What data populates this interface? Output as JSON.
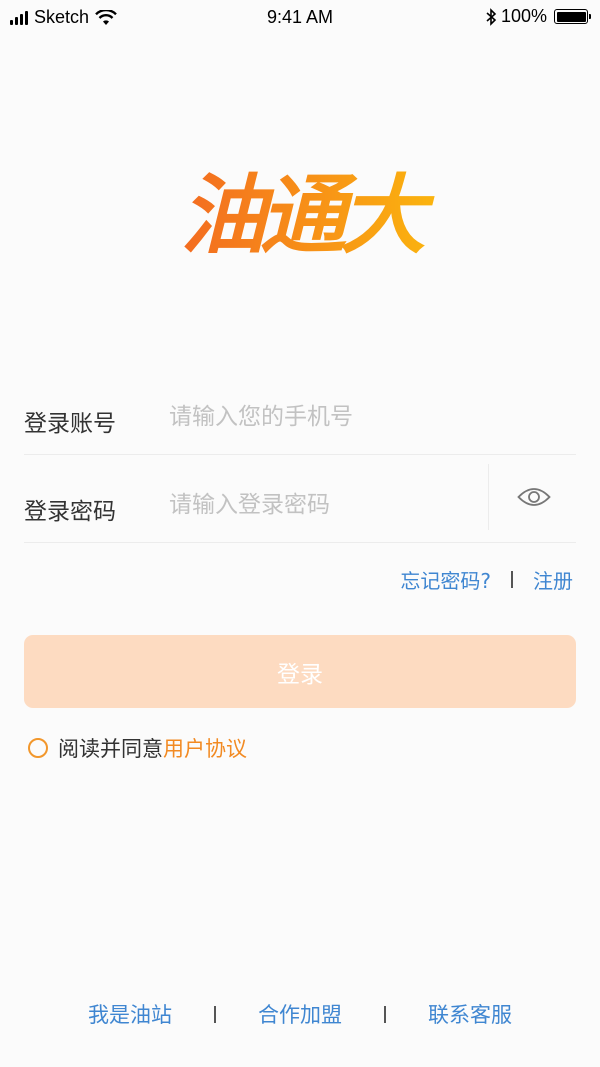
{
  "status_bar": {
    "carrier": "Sketch",
    "time": "9:41 AM",
    "battery": "100%"
  },
  "brand": {
    "logo_text": "油通大",
    "gradient_start": "#f36b21",
    "gradient_end": "#fbb40e"
  },
  "form": {
    "account_label": "登录账号",
    "account_placeholder": "请输入您的手机号",
    "password_label": "登录密码",
    "password_placeholder": "请输入登录密码"
  },
  "links": {
    "forgot_password": "忘记密码?",
    "register": "注册"
  },
  "login_button": "登录",
  "agreement": {
    "prefix": "阅读并同意",
    "link": "用户协议"
  },
  "footer": {
    "items": [
      "我是油站",
      "合作加盟",
      "联系客服"
    ]
  },
  "colors": {
    "link": "#3f86d1",
    "accent": "#f28a22",
    "button_disabled": "#fddbc1"
  }
}
